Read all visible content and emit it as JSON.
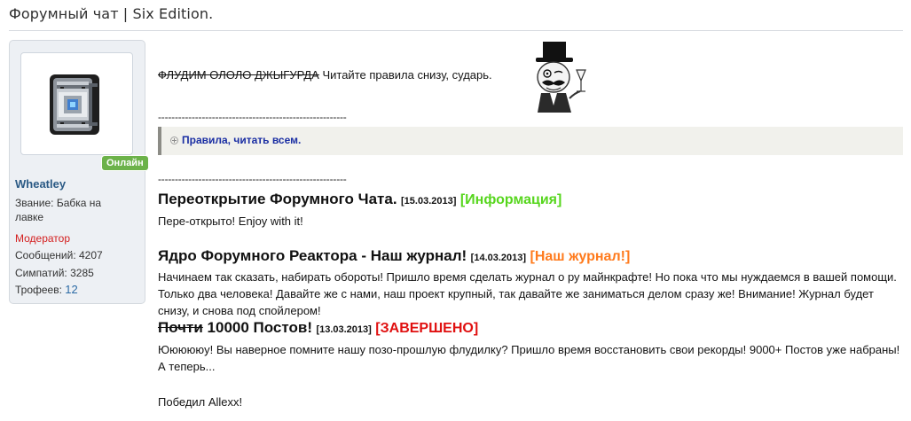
{
  "thread": {
    "title": "Форумный чат | Six Edition."
  },
  "user": {
    "online_label": "Онлайн",
    "name": "Wheatley",
    "rank": "Звание: Бабка на лавке",
    "role": "Модератор",
    "posts": "Сообщений: 4207",
    "likes": "Симпатий: 3285",
    "trophies_label": "Трофеев:",
    "trophies_value": "12"
  },
  "post": {
    "struck_text": "ФЛУДИМ ОЛОЛО ДЖЫГУРДА",
    "intro_text": " Читайте правила снизу, сударь.",
    "divider": "--------------------------------------------------------",
    "spoiler_label": "Правила, читать всем.",
    "news": [
      {
        "title": "Переоткрытие Форумного Чата.",
        "date": "[15.03.2013]",
        "tag": "[Информация]",
        "text": "Пере-открыто! Enjoy with it!"
      },
      {
        "title": "Ядро Форумного Реактора - Наш журнал!",
        "date": "[14.03.2013]",
        "tag": "[Наш журнал!]",
        "text": "Начинаем так сказать, набирать обороты! Пришло время сделать журнал о ру майнкрафте! Но пока что мы нуждаемся в вашей помощи. Только два человека! Давайте же с нами, наш проект крупный, так давайте же заниматься делом сразу же! Внимание! Журнал будет снизу, и снова под спойлером!"
      },
      {
        "title_struck": "Почти",
        "title": " 10000 Постов!",
        "date": "[13.03.2013]",
        "tag": "[ЗАВЕРШЕНО]",
        "text": "Юююююу! Вы наверное помните нашу позо-прошлую флудилку? Пришло время восстановить свои рекорды! 9000+ Постов уже набраны! А теперь...",
        "footer": "Победил Allexx!"
      }
    ]
  },
  "colors": {
    "accent_link": "#2b5a85",
    "moderator": "#d42020",
    "online": "#6cb24a",
    "tag_info": "#57d61e",
    "tag_journal": "#ff7a1c",
    "tag_done": "#e01010"
  }
}
